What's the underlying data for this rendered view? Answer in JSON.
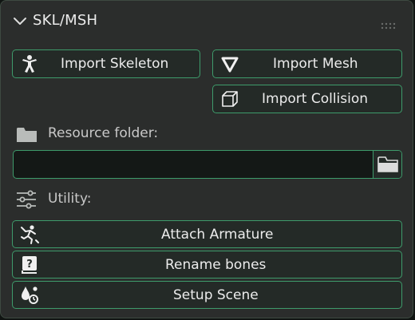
{
  "panel": {
    "title": "SKL/MSH",
    "collapse_icon": "chevron-down-icon",
    "drag_icon": "grip-dots-icon"
  },
  "import": {
    "skeleton_label": "Import Skeleton",
    "skeleton_icon": "armature-figure-icon",
    "mesh_label": "Import Mesh",
    "mesh_icon": "triangle-mesh-icon",
    "collision_label": "Import Collision",
    "collision_icon": "cube-outline-icon"
  },
  "resource": {
    "label": "Resource folder:",
    "label_icon": "folder-icon",
    "value": "",
    "browse_icon": "folder-browse-icon"
  },
  "utility": {
    "label": "Utility:",
    "label_icon": "sliders-icon",
    "attach_label": "Attach Armature",
    "attach_icon": "pose-figure-icon",
    "rename_label": "Rename bones",
    "rename_icon": "help-book-icon",
    "setup_label": "Setup Scene",
    "setup_icon": "scene-shapes-icon"
  },
  "colors": {
    "panel_bg": "#2b2d2c",
    "button_bg": "#242a27",
    "accent_border": "#3e9b6b",
    "field_bg": "#141816",
    "text": "#ececec"
  }
}
